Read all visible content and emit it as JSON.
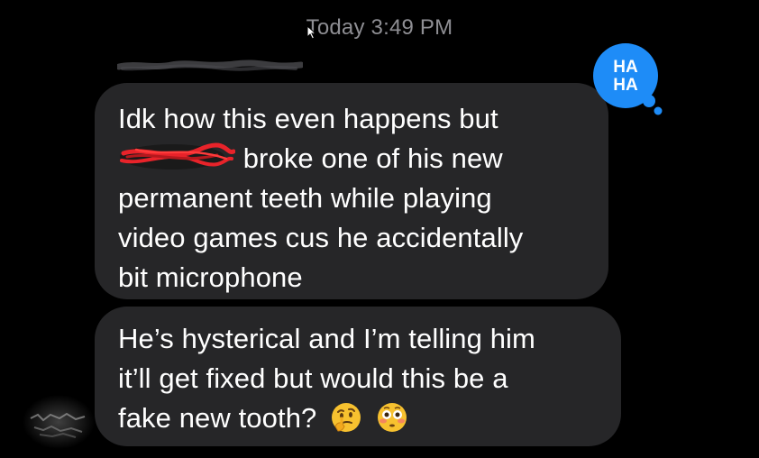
{
  "conversation": {
    "timestamp": "Today 3:49 PM",
    "sender_name_redacted": true
  },
  "messages": [
    {
      "lines": [
        "Idk how this even happens but",
        "broke one of his new",
        "permanent teeth while playing",
        "video games cus he accidentally",
        "bit microphone"
      ],
      "redacted_name": true,
      "reaction": {
        "label": "HA HA",
        "line1": "HA",
        "line2": "HA",
        "color": "#1e8cf7"
      }
    },
    {
      "lines": [
        "He’s hysterical and I’m telling him",
        "it’ll get fixed but would this be a",
        "fake new tooth?"
      ],
      "emojis": [
        "thinking-face-emoji",
        "flushed-face-emoji"
      ]
    }
  ],
  "colors": {
    "background": "#000000",
    "bubble": "#262628",
    "timestamp": "#8e8e93",
    "text": "#ffffff",
    "redaction": "#e8232a",
    "reaction_badge": "#1e8cf7"
  }
}
